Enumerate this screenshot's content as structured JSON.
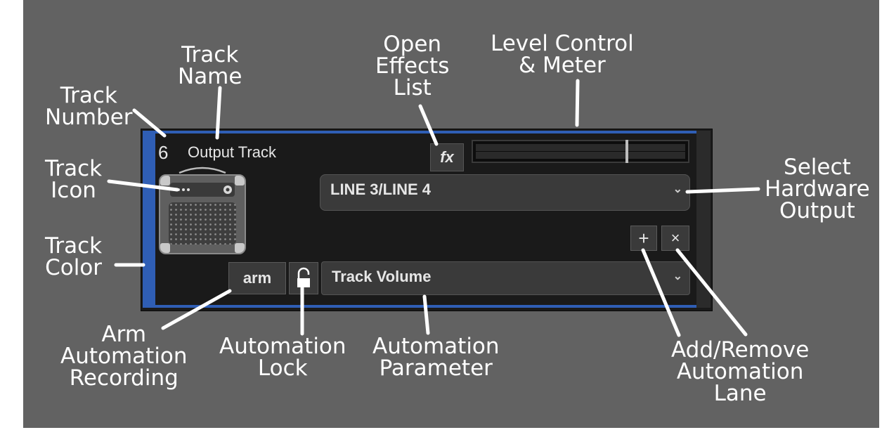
{
  "track": {
    "number": "6",
    "name": "Output Track",
    "color": "#2f5eb5",
    "icon": "guitar-amp-icon",
    "fx_label": "fx",
    "hardware_output": "LINE 3/LINE 4",
    "automation_parameter": "Track Volume",
    "arm_label": "arm",
    "add_lane_symbol": "+",
    "remove_lane_symbol": "×",
    "dropdown_chevron": "⌄",
    "level_fraction": 0.72
  },
  "callouts": {
    "track_number": [
      "Track",
      "Number"
    ],
    "track_name": [
      "Track",
      "Name"
    ],
    "open_effects": [
      "Open",
      "Effects",
      "List"
    ],
    "level_control": [
      "Level Control",
      "& Meter"
    ],
    "track_icon": [
      "Track",
      "Icon"
    ],
    "select_output": [
      "Select",
      "Hardware",
      "Output"
    ],
    "track_color": [
      "Track",
      "Color"
    ],
    "arm_automation": [
      "Arm",
      "Automation",
      "Recording"
    ],
    "automation_lock": [
      "Automation",
      "Lock"
    ],
    "automation_parameter": [
      "Automation",
      "Parameter"
    ],
    "add_remove_lane": [
      "Add/Remove",
      "Automation",
      "Lane"
    ]
  }
}
